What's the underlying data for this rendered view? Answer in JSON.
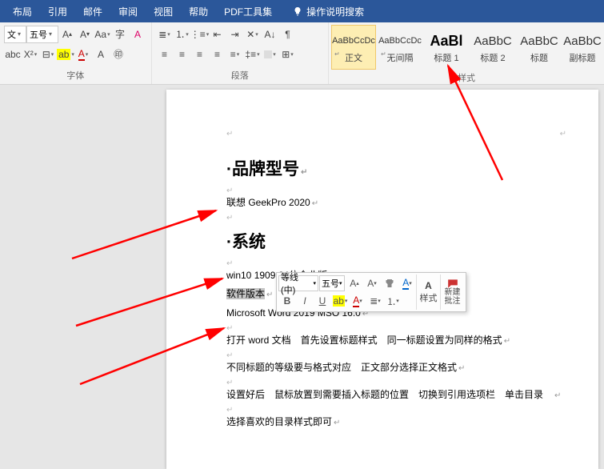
{
  "menu": {
    "items": [
      "布局",
      "引用",
      "邮件",
      "审阅",
      "视图",
      "帮助",
      "PDF工具集"
    ],
    "search_hint": "操作说明搜索"
  },
  "ribbon": {
    "font": {
      "label": "字体",
      "font_box": "文",
      "size_box": "五号"
    },
    "paragraph": {
      "label": "段落"
    },
    "styles": {
      "label": "样式",
      "items": [
        {
          "preview": "AaBbCcDc",
          "name": "正文",
          "big": false,
          "selected": true,
          "corner": "↵"
        },
        {
          "preview": "AaBbCcDc",
          "name": "无间隔",
          "big": false,
          "selected": false,
          "corner": "↵"
        },
        {
          "preview": "AaBl",
          "name": "标题 1",
          "big": true,
          "selected": false
        },
        {
          "preview": "AaBbC",
          "name": "标题 2",
          "big": false,
          "selected": false
        },
        {
          "preview": "AaBbC",
          "name": "标题",
          "big": false,
          "selected": false
        },
        {
          "preview": "AaBbC",
          "name": "副标题",
          "big": false,
          "selected": false
        }
      ]
    }
  },
  "doc": {
    "h1": "品牌型号",
    "p1": "联想 GeekPro 2020",
    "h2": "系统",
    "p2": "win10 1909 64位企业版",
    "sel": "软件版本",
    "p3": "Microsoft Word 2019 MSO 16.0",
    "p4": "打开 word 文档　首先设置标题样式　同一标题设置为同样的格式",
    "p5": "不同标题的等级要与格式对应　正文部分选择正文格式",
    "p6": "设置好后　鼠标放置到需要插入标题的位置　切换到引用选项栏　单击目录　",
    "p7": "选择喜欢的目录样式即可"
  },
  "mini": {
    "font": "等线 (中)",
    "size": "五号",
    "styles": "样式",
    "comment": "新建\n批注"
  }
}
